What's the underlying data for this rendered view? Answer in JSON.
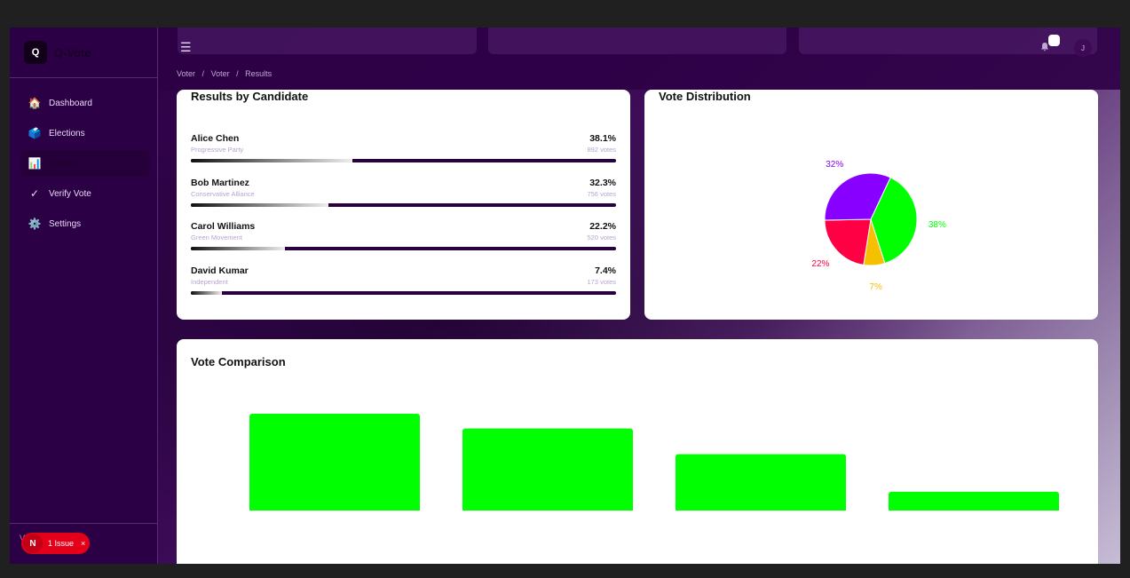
{
  "app": {
    "logo_letter": "Q",
    "name": "Q-Vote"
  },
  "sidebar": {
    "items": [
      {
        "label": "Dashboard",
        "icon": "house-icon",
        "glyph": "🏠"
      },
      {
        "label": "Elections",
        "icon": "ballot-box-icon",
        "glyph": "🗳️"
      },
      {
        "label": "Results",
        "icon": "bar-chart-icon",
        "glyph": "📊"
      },
      {
        "label": "Verify Vote",
        "icon": "checkmark-icon",
        "glyph": "✓"
      },
      {
        "label": "Settings",
        "icon": "gear-icon",
        "glyph": "⚙️"
      }
    ],
    "footer_letter": "V",
    "issue": {
      "letter": "N",
      "text": "1 Issue",
      "close": "×"
    }
  },
  "header": {
    "menu_glyph": "☰",
    "breadcrumb": [
      "Voter",
      "/",
      "Voter",
      "/",
      "Results"
    ],
    "avatar_letter": "J"
  },
  "results": {
    "title": "Results by Candidate",
    "candidates": [
      {
        "name": "Alice Chen",
        "party": "Progressive Party",
        "pct": "38.1%",
        "votes": "892 votes",
        "share": 0.381
      },
      {
        "name": "Bob Martinez",
        "party": "Conservative Alliance",
        "pct": "32.3%",
        "votes": "756 votes",
        "share": 0.323
      },
      {
        "name": "Carol Williams",
        "party": "Green Movement",
        "pct": "22.2%",
        "votes": "520 votes",
        "share": 0.222
      },
      {
        "name": "David Kumar",
        "party": "Independent",
        "pct": "7.4%",
        "votes": "173 votes",
        "share": 0.074
      }
    ]
  },
  "distribution": {
    "title": "Vote Distribution",
    "chart_data": {
      "type": "pie",
      "slices": [
        {
          "label": "38%",
          "value": 38.1,
          "color": "#00ff00"
        },
        {
          "label": "7%",
          "value": 7.4,
          "color": "#f5c000"
        },
        {
          "label": "22%",
          "value": 22.2,
          "color": "#ff0044"
        },
        {
          "label": "32%",
          "value": 32.3,
          "color": "#8800ff"
        }
      ]
    }
  },
  "comparison": {
    "title": "Vote Comparison",
    "chart_data": {
      "type": "bar",
      "values": [
        892,
        756,
        520,
        173
      ],
      "color": "#00ff00",
      "ylim": [
        0,
        1800
      ]
    }
  }
}
